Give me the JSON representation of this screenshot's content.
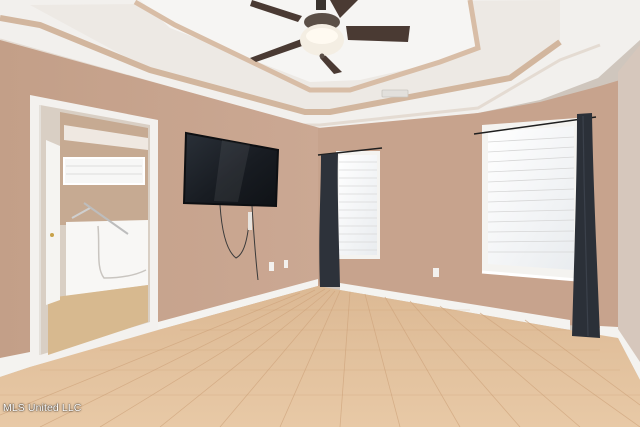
{
  "photo": {
    "subject": "empty-bedroom-interior",
    "watermark": "MLS United LLC"
  },
  "colors": {
    "wall": "#c9a690",
    "ceiling": "#f3f1ee",
    "trim": "#f4f3f0",
    "floor": "#e3c29c",
    "curtain": "#2b3038",
    "tv": "#1b1f25"
  }
}
